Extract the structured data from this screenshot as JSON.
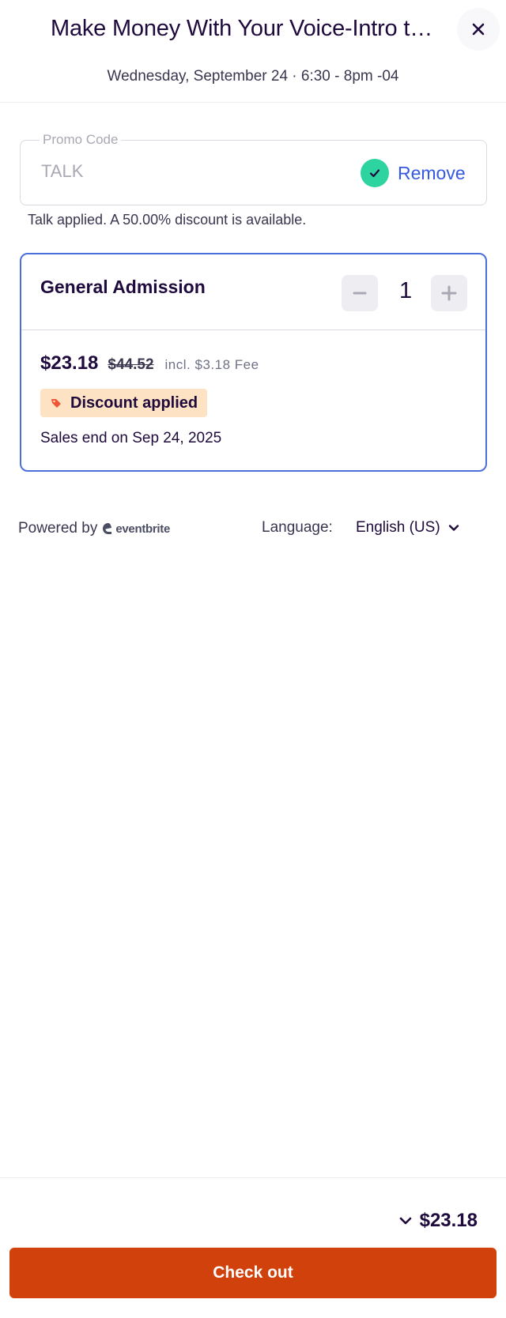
{
  "header": {
    "title": "Make Money With Your Voice-Intro t…",
    "date": "Wednesday, September 24 · 6:30 - 8pm -04",
    "close_icon": "close-icon"
  },
  "promo": {
    "legend": "Promo Code",
    "value": "TALK",
    "status_icon": "check-circle-icon",
    "remove_label": "Remove",
    "message": "Talk applied. A 50.00% discount is available."
  },
  "ticket": {
    "name": "General Admission",
    "quantity": "1",
    "minus_icon": "minus-icon",
    "plus_icon": "plus-icon",
    "price": "$23.18",
    "original_price": "$44.52",
    "fee_note": "incl. $3.18 Fee",
    "discount_badge": "Discount applied",
    "discount_icon": "tag-icon",
    "sales_end": "Sales end on Sep 24, 2025"
  },
  "footer_links": {
    "powered_by": "Powered by",
    "brand": "eventbrite",
    "language_label": "Language:",
    "language_value": "English (US)"
  },
  "checkout": {
    "total": "$23.18",
    "button_label": "Check out"
  },
  "colors": {
    "accent": "#d1410c",
    "link": "#3659e3",
    "card_border": "#4a6fd8",
    "success": "#2dd4a0",
    "badge_bg": "#fde3c3"
  }
}
